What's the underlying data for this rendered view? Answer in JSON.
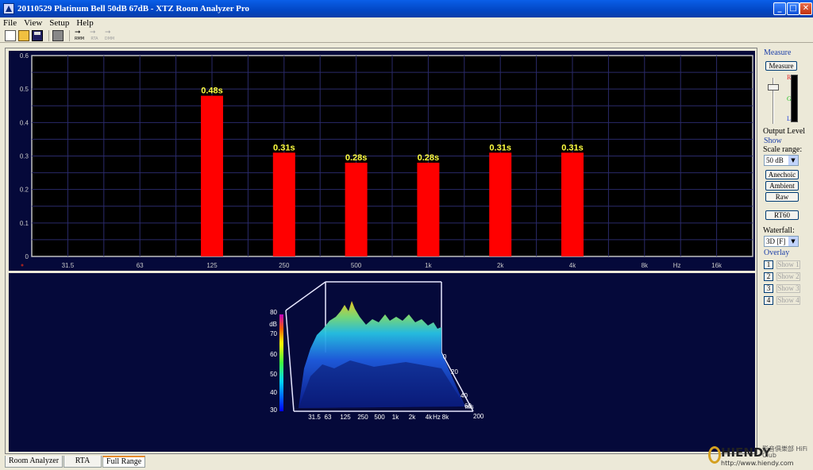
{
  "window": {
    "title": "20110529 Platinum Bell 50dB 67dB - XTZ Room Analyzer Pro",
    "min_glyph": "_",
    "max_glyph": "□",
    "close_glyph": "✕"
  },
  "menu": [
    "File",
    "View",
    "Setup",
    "Help"
  ],
  "toolbar": {
    "buttons": [
      "new-icon",
      "open-icon",
      "save-icon",
      "print-icon"
    ],
    "modes": [
      "RMM",
      "RTA",
      "DMM"
    ]
  },
  "chart_data": [
    {
      "type": "bar",
      "categories": [
        "31.5",
        "63",
        "125",
        "250",
        "500",
        "1k",
        "2k",
        "4k",
        "8k",
        "16k"
      ],
      "values": [
        null,
        null,
        0.48,
        0.31,
        0.28,
        0.28,
        0.31,
        0.31,
        null,
        null
      ],
      "data_labels": [
        "",
        "",
        "0.48s",
        "0.31s",
        "0.28s",
        "0.28s",
        "0.31s",
        "0.31s",
        "",
        ""
      ],
      "x_unit_label": "Hz",
      "ylim": [
        0,
        0.6
      ],
      "yticks": [
        "0",
        "0.1",
        "0.2",
        "0.3",
        "0.4",
        "0.5",
        "0.6"
      ],
      "grid": true,
      "colors": {
        "bar": "#ff0000",
        "label": "#ffff40",
        "background": "#000000",
        "grid": "#2a2a6a"
      }
    },
    {
      "type": "area",
      "z_label": "dB",
      "z_ticks": [
        "80",
        "70",
        "60",
        "50",
        "40",
        "30"
      ],
      "x_ticks": [
        "31.5",
        "63",
        "125",
        "250",
        "500",
        "1k",
        "2k",
        "4k",
        "8k"
      ],
      "x_unit": "Hz",
      "y_ticks": [
        "0",
        "20",
        "40",
        "60",
        "200"
      ],
      "y_unit": "ms",
      "zlim": [
        30,
        80
      ]
    }
  ],
  "sidebar": {
    "measure_group": "Measure",
    "measure_button": "Measure",
    "level_marks": [
      "R",
      "G",
      "L"
    ],
    "output_level_label": "Output Level",
    "output_level_value": 0.85,
    "show_group": "Show",
    "scale_range_label": "Scale range:",
    "scale_range_value": "50 dB",
    "anechoic_button": "Anechoic",
    "ambient_button": "Ambient",
    "raw_button": "Raw",
    "rt60_button": "RT60",
    "waterfall_label": "Waterfall:",
    "waterfall_value": "3D [F]",
    "overlay_group": "Overlay",
    "overlay_items": [
      {
        "num": "1",
        "label": "Show 1"
      },
      {
        "num": "2",
        "label": "Show 2"
      },
      {
        "num": "3",
        "label": "Show 3"
      },
      {
        "num": "4",
        "label": "Show 4"
      }
    ]
  },
  "tabs": [
    "Room Analyzer",
    "RTA",
    "Full Range"
  ],
  "active_tab": 2,
  "watermark": {
    "brand": "HIENDY",
    "sub": "影音俱樂部 HiFi Club",
    "url": "http://www.hiendy.com"
  }
}
